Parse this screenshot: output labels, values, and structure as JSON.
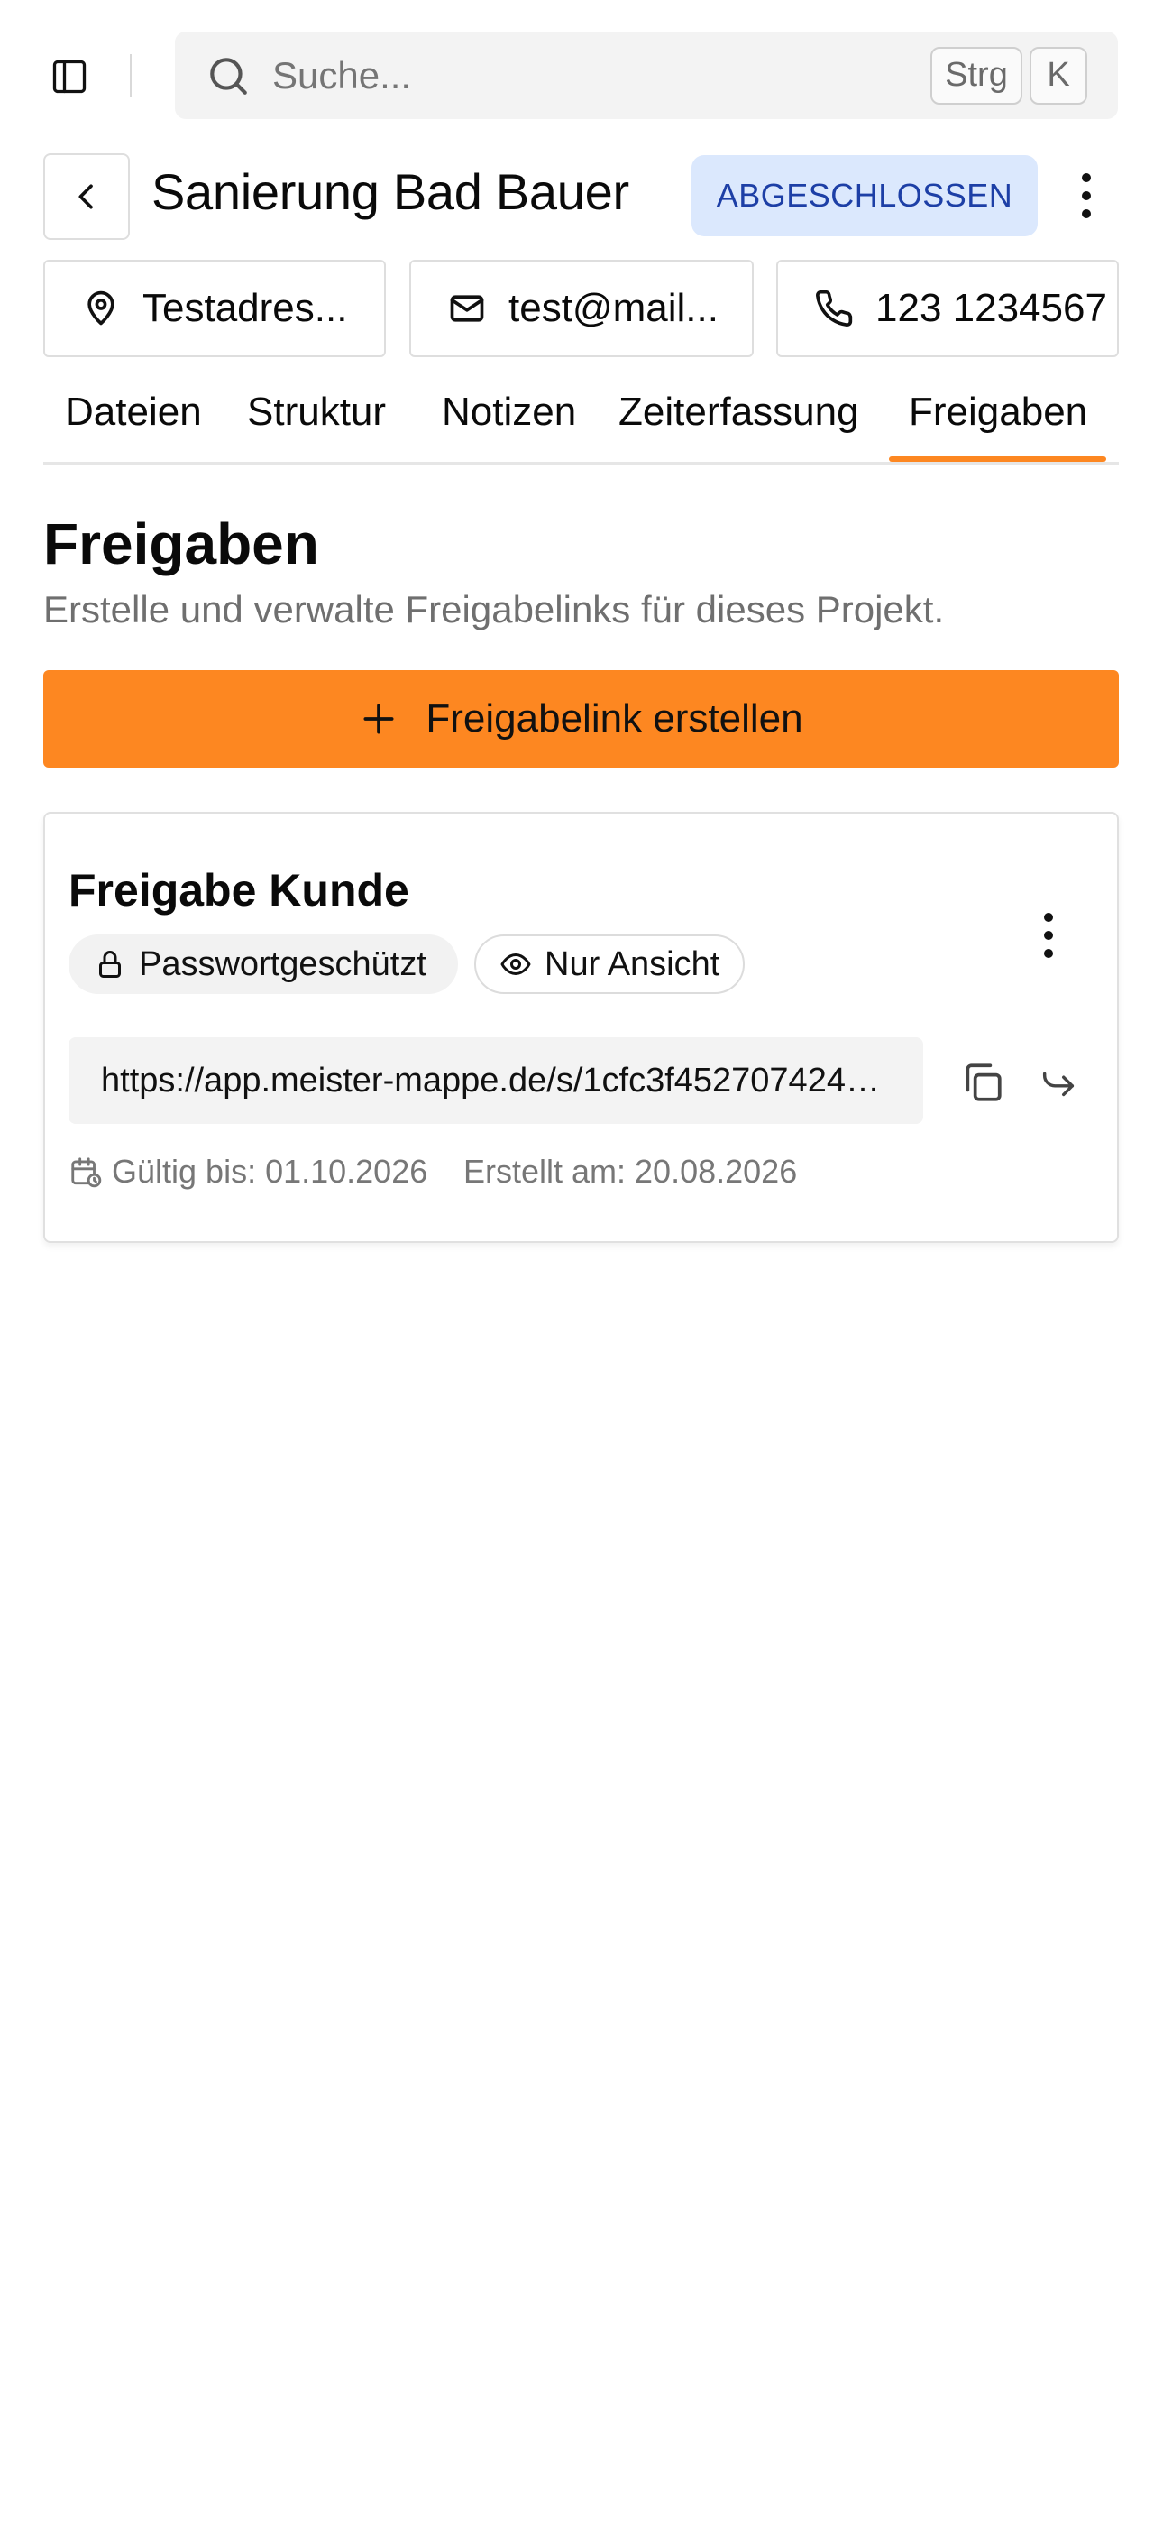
{
  "search": {
    "placeholder": "Suche...",
    "shortcut_key1": "Strg",
    "shortcut_key2": "K"
  },
  "project": {
    "title": "Sanierung Bad Bauer",
    "status": "ABGESCHLOSSEN",
    "status_color": "#1d3fa6",
    "status_bg": "#dbe8fd"
  },
  "contact": {
    "address": "Testadres...",
    "email": "test@mail...",
    "phone": "123 1234567"
  },
  "tabs": [
    {
      "label": "Dateien",
      "active": false
    },
    {
      "label": "Struktur",
      "active": false
    },
    {
      "label": "Notizen",
      "active": false
    },
    {
      "label": "Zeiterfassung",
      "active": false
    },
    {
      "label": "Freigaben",
      "active": true
    }
  ],
  "section": {
    "title": "Freigaben",
    "subtitle": "Erstelle und verwalte Freigabelinks für dieses Projekt.",
    "create_button": "Freigabelink erstellen"
  },
  "shares": [
    {
      "title": "Freigabe Kunde",
      "tags": [
        "Passwortgeschützt",
        "Nur Ansicht"
      ],
      "url": "https://app.meister-mappe.de/s/1cfc3f452707424d...",
      "valid_until": "Gültig bis: 01.10.2026",
      "created_at": "Erstellt am: 20.08.2026"
    }
  ],
  "colors": {
    "accent": "#fd8721",
    "chip_border": "#dedede",
    "muted_text": "#6f6f6f"
  },
  "icons": {
    "sidebar_toggle": "sidebar-toggle-icon",
    "search": "search-icon",
    "back": "chevron-left-icon",
    "more": "more-vertical-icon",
    "address": "map-pin-icon",
    "email": "mail-icon",
    "phone": "phone-icon",
    "plus": "plus-icon",
    "lock": "lock-icon",
    "eye": "eye-icon",
    "copy": "copy-icon",
    "share": "share-forward-icon",
    "calendar": "calendar-clock-icon"
  }
}
